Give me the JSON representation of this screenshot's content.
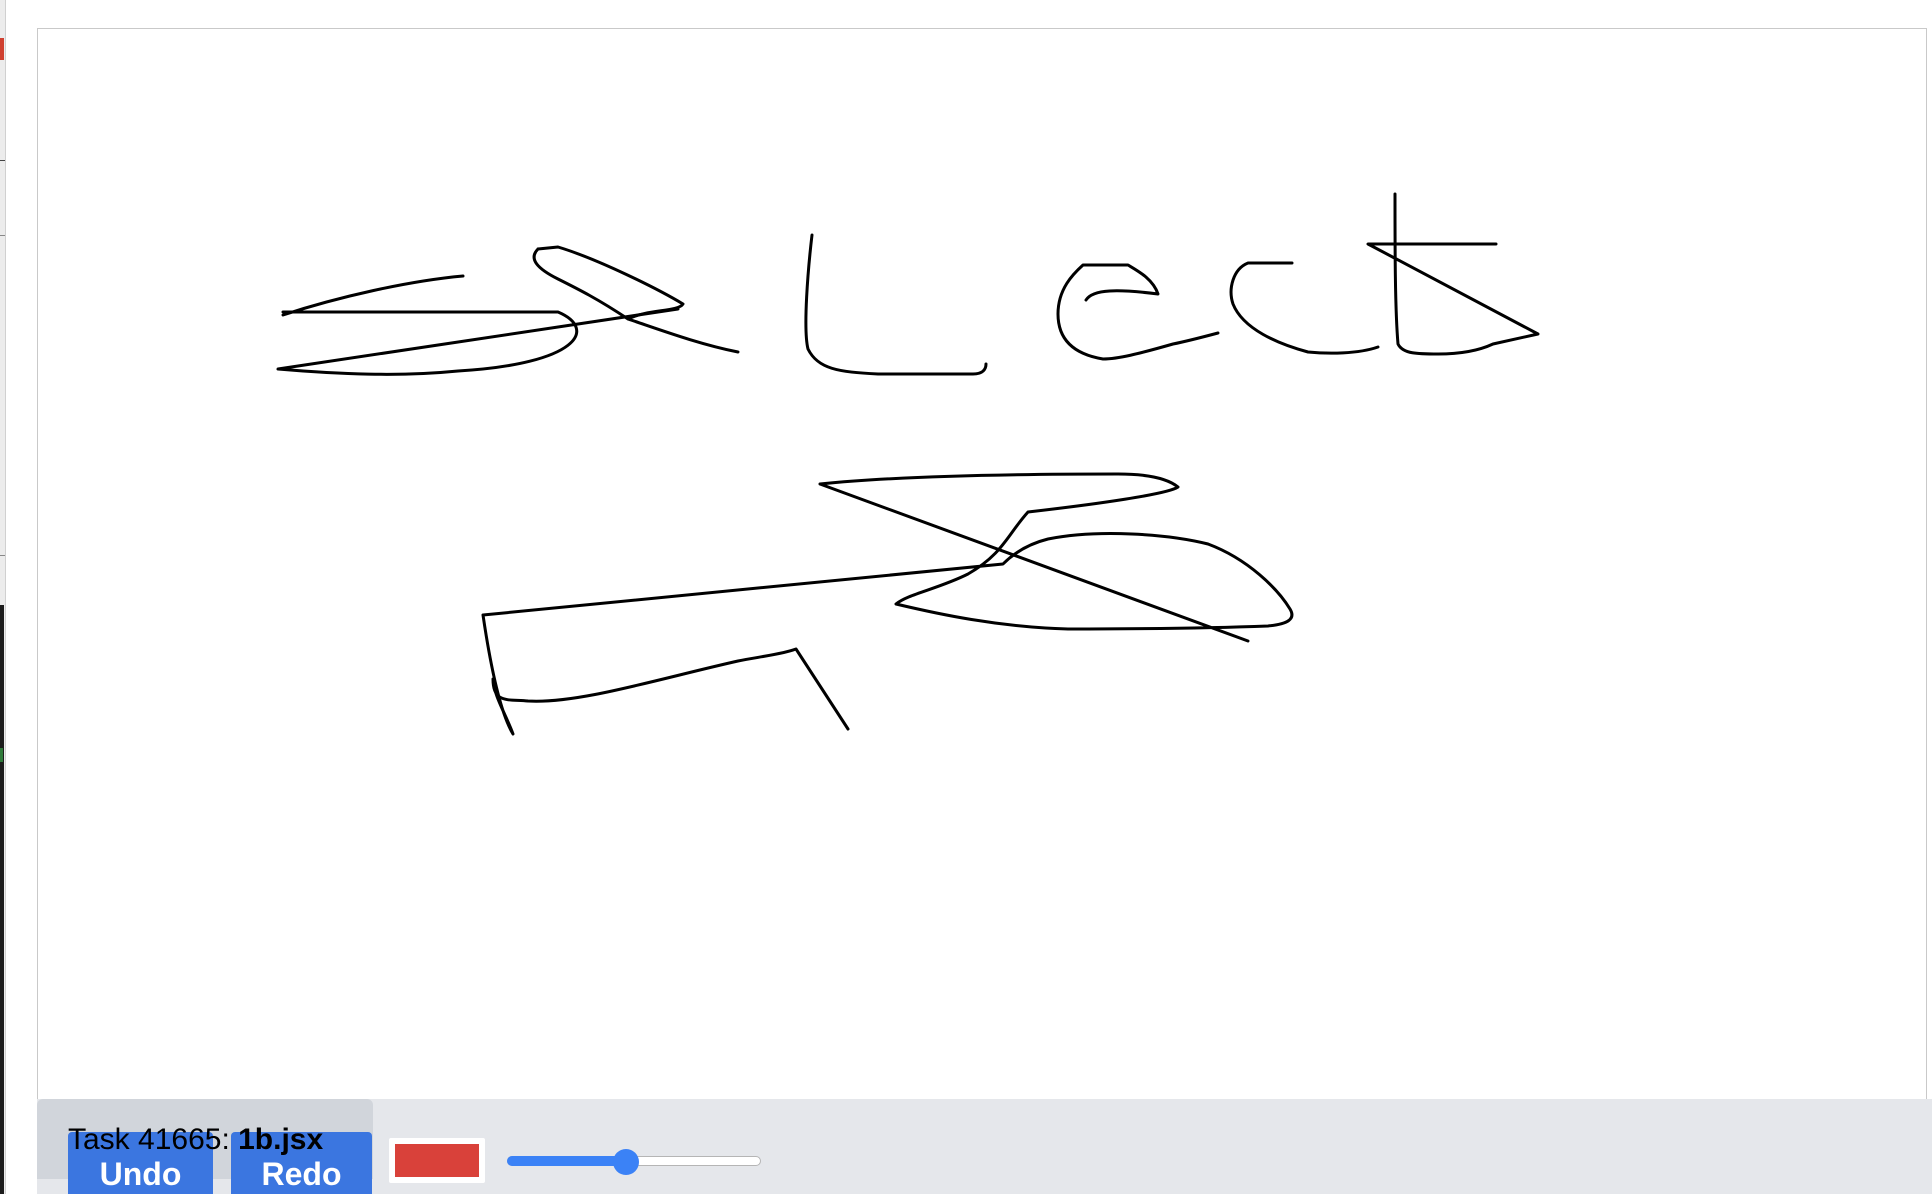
{
  "task": {
    "prefix": "Task 41665: ",
    "filename": "1b.jsx"
  },
  "toolbar": {
    "undo_label": "Undo",
    "redo_label": "Redo",
    "color": "#d9413a",
    "stroke_width_fraction": 0.44
  },
  "canvas": {
    "stroke_color": "#000000",
    "content": "handwritten sketch strokes"
  },
  "theme": {
    "button_color": "#3b76e0",
    "toolbar_bg": "#e5e7eb",
    "slider_accent": "#3b82f6"
  }
}
